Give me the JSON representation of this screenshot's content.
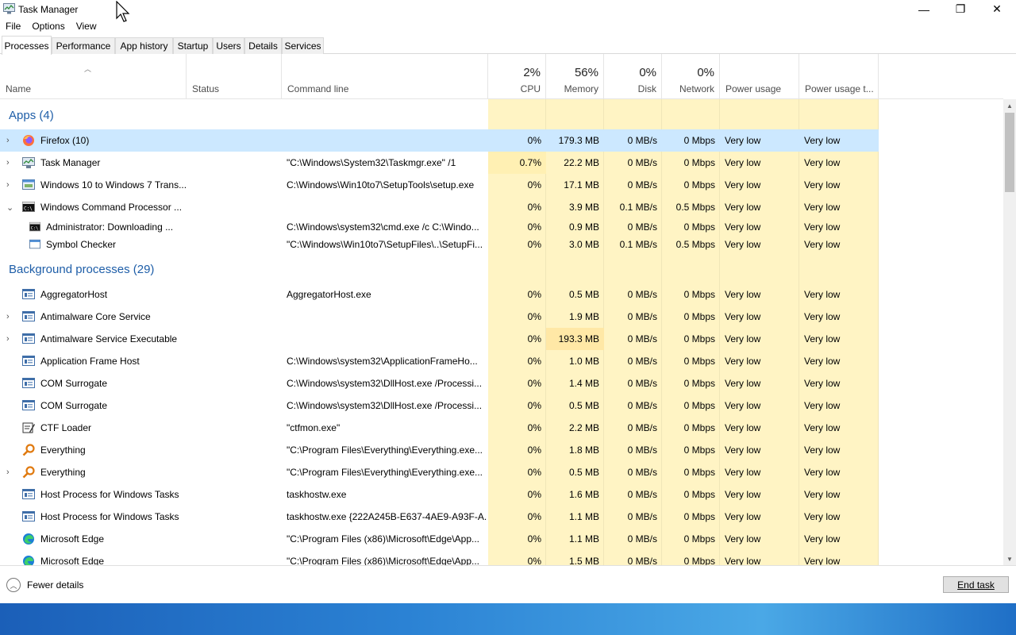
{
  "window": {
    "title": "Task Manager",
    "controls": {
      "minimize": "—",
      "maximize": "❐",
      "close": "✕"
    }
  },
  "menu": [
    "File",
    "Options",
    "View"
  ],
  "tabs": [
    "Processes",
    "Performance",
    "App history",
    "Startup",
    "Users",
    "Details",
    "Services"
  ],
  "active_tab": "Processes",
  "columns": {
    "name": "Name",
    "status": "Status",
    "command_line": "Command line",
    "cpu": {
      "pct": "2%",
      "label": "CPU"
    },
    "memory": {
      "pct": "56%",
      "label": "Memory"
    },
    "disk": {
      "pct": "0%",
      "label": "Disk"
    },
    "network": {
      "pct": "0%",
      "label": "Network"
    },
    "power": "Power usage",
    "power_trend": "Power usage t..."
  },
  "groups": {
    "apps": "Apps (4)",
    "background": "Background processes (29)"
  },
  "apps": [
    {
      "chev": "›",
      "icon": "firefox-icon",
      "name": "Firefox (10)",
      "cmd": "",
      "cpu": "0%",
      "mem": "179.3 MB",
      "disk": "0 MB/s",
      "net": "0 Mbps",
      "power": "Very low",
      "trend": "Very low",
      "selected": true
    },
    {
      "chev": "›",
      "icon": "task-manager-icon",
      "name": "Task Manager",
      "cmd": "\"C:\\Windows\\System32\\Taskmgr.exe\"  /1",
      "cpu": "0.7%",
      "mem": "22.2 MB",
      "disk": "0 MB/s",
      "net": "0 Mbps",
      "power": "Very low",
      "trend": "Very low"
    },
    {
      "chev": "›",
      "icon": "setup-icon",
      "name": "Windows 10 to Windows 7 Trans...",
      "cmd": "C:\\Windows\\Win10to7\\SetupTools\\setup.exe",
      "cpu": "0%",
      "mem": "17.1 MB",
      "disk": "0 MB/s",
      "net": "0 Mbps",
      "power": "Very low",
      "trend": "Very low"
    },
    {
      "chev": "⌄",
      "icon": "cmd-icon",
      "name": "Windows Command Processor ...",
      "cmd": "",
      "cpu": "0%",
      "mem": "3.9 MB",
      "disk": "0.1 MB/s",
      "net": "0.5 Mbps",
      "power": "Very low",
      "trend": "Very low"
    }
  ],
  "app_children": [
    {
      "icon": "cmd-icon",
      "name": "Administrator:  Downloading ...",
      "cmd": "C:\\Windows\\system32\\cmd.exe /c C:\\Windo...",
      "cpu": "0%",
      "mem": "0.9 MB",
      "disk": "0 MB/s",
      "net": "0 Mbps",
      "power": "Very low",
      "trend": "Very low"
    },
    {
      "icon": "app-window-icon",
      "name": "Symbol Checker",
      "cmd": "\"C:\\Windows\\Win10to7\\SetupFiles\\..\\SetupFi...",
      "cpu": "0%",
      "mem": "3.0 MB",
      "disk": "0.1 MB/s",
      "net": "0.5 Mbps",
      "power": "Very low",
      "trend": "Very low"
    }
  ],
  "background": [
    {
      "chev": "",
      "icon": "service-icon",
      "name": "AggregatorHost",
      "cmd": "AggregatorHost.exe",
      "cpu": "0%",
      "mem": "0.5 MB",
      "disk": "0 MB/s",
      "net": "0 Mbps",
      "power": "Very low",
      "trend": "Very low"
    },
    {
      "chev": "›",
      "icon": "service-icon",
      "name": "Antimalware Core Service",
      "cmd": "",
      "cpu": "0%",
      "mem": "1.9 MB",
      "disk": "0 MB/s",
      "net": "0 Mbps",
      "power": "Very low",
      "trend": "Very low"
    },
    {
      "chev": "›",
      "icon": "service-icon",
      "name": "Antimalware Service Executable",
      "cmd": "",
      "cpu": "0%",
      "mem": "193.3 MB",
      "disk": "0 MB/s",
      "net": "0 Mbps",
      "power": "Very low",
      "trend": "Very low",
      "mem_hot": true
    },
    {
      "chev": "",
      "icon": "service-icon",
      "name": "Application Frame Host",
      "cmd": "C:\\Windows\\system32\\ApplicationFrameHo...",
      "cpu": "0%",
      "mem": "1.0 MB",
      "disk": "0 MB/s",
      "net": "0 Mbps",
      "power": "Very low",
      "trend": "Very low"
    },
    {
      "chev": "",
      "icon": "service-icon",
      "name": "COM Surrogate",
      "cmd": "C:\\Windows\\system32\\DllHost.exe /Processi...",
      "cpu": "0%",
      "mem": "1.4 MB",
      "disk": "0 MB/s",
      "net": "0 Mbps",
      "power": "Very low",
      "trend": "Very low"
    },
    {
      "chev": "",
      "icon": "service-icon",
      "name": "COM Surrogate",
      "cmd": "C:\\Windows\\system32\\DllHost.exe /Processi...",
      "cpu": "0%",
      "mem": "0.5 MB",
      "disk": "0 MB/s",
      "net": "0 Mbps",
      "power": "Very low",
      "trend": "Very low"
    },
    {
      "chev": "",
      "icon": "ctf-loader-icon",
      "name": "CTF Loader",
      "cmd": "\"ctfmon.exe\"",
      "cpu": "0%",
      "mem": "2.2 MB",
      "disk": "0 MB/s",
      "net": "0 Mbps",
      "power": "Very low",
      "trend": "Very low"
    },
    {
      "chev": "",
      "icon": "everything-search-icon",
      "name": "Everything",
      "cmd": "\"C:\\Program Files\\Everything\\Everything.exe...",
      "cpu": "0%",
      "mem": "1.8 MB",
      "disk": "0 MB/s",
      "net": "0 Mbps",
      "power": "Very low",
      "trend": "Very low"
    },
    {
      "chev": "›",
      "icon": "everything-search-icon",
      "name": "Everything",
      "cmd": "\"C:\\Program Files\\Everything\\Everything.exe...",
      "cpu": "0%",
      "mem": "0.5 MB",
      "disk": "0 MB/s",
      "net": "0 Mbps",
      "power": "Very low",
      "trend": "Very low"
    },
    {
      "chev": "",
      "icon": "service-icon",
      "name": "Host Process for Windows Tasks",
      "cmd": "taskhostw.exe",
      "cpu": "0%",
      "mem": "1.6 MB",
      "disk": "0 MB/s",
      "net": "0 Mbps",
      "power": "Very low",
      "trend": "Very low"
    },
    {
      "chev": "",
      "icon": "service-icon",
      "name": "Host Process for Windows Tasks",
      "cmd": "taskhostw.exe {222A245B-E637-4AE9-A93F-A...",
      "cpu": "0%",
      "mem": "1.1 MB",
      "disk": "0 MB/s",
      "net": "0 Mbps",
      "power": "Very low",
      "trend": "Very low"
    },
    {
      "chev": "",
      "icon": "edge-icon",
      "name": "Microsoft Edge",
      "cmd": "\"C:\\Program Files (x86)\\Microsoft\\Edge\\App...",
      "cpu": "0%",
      "mem": "1.1 MB",
      "disk": "0 MB/s",
      "net": "0 Mbps",
      "power": "Very low",
      "trend": "Very low"
    },
    {
      "chev": "",
      "icon": "edge-icon",
      "name": "Microsoft Edge",
      "cmd": "\"C:\\Program Files (x86)\\Microsoft\\Edge\\App...",
      "cpu": "0%",
      "mem": "1.5 MB",
      "disk": "0 MB/s",
      "net": "0 Mbps",
      "power": "Very low",
      "trend": "Very low"
    }
  ],
  "footer": {
    "fewer_details": "Fewer details",
    "end_task": "End task"
  },
  "colors": {
    "group_header": "#1e5ea8",
    "selected_row": "#cce8ff",
    "usage_bg": "#fff4c4",
    "mem_hot": "#ffe8a6",
    "cpu_light": "#fff0b3"
  }
}
